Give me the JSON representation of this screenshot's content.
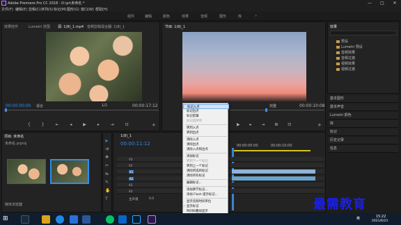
{
  "window": {
    "title": "Adobe Premiere Pro CC 2018 - D:\\pr\\未命名 *",
    "controls": [
      "—",
      "□",
      "✕"
    ]
  },
  "menu": [
    "文件(F)",
    "编辑(E)",
    "剪辑(C)",
    "序列(S)",
    "标记(M)",
    "图形(G)",
    "窗口(W)",
    "帮助(H)"
  ],
  "workspaces": [
    "组件",
    "编辑",
    "颜色",
    "效果",
    "音频",
    "图形",
    "库"
  ],
  "workspaces_overflow": "»",
  "source_panel": {
    "tabs": [
      "效果控件",
      "Lumetri 范围",
      "源: 1(8)_1.mp4",
      "音频剪辑混合器: 1(8)_1"
    ],
    "active_tab": 2,
    "timecode_left": "00:00:00:00",
    "fit": "适合",
    "ratio": "1/2",
    "timecode_right": "00:00:17:12"
  },
  "program_panel": {
    "tab": "节目: 1(8)_1",
    "fit": "完整",
    "timecode_right": "00:00:10:08"
  },
  "context_menu": {
    "items": [
      {
        "label": "标记入点",
        "disabled": false,
        "highlight": true
      },
      {
        "label": "标记出点",
        "disabled": false
      },
      {
        "label": "标记剪辑",
        "disabled": false
      },
      {
        "label": "标记选择项",
        "disabled": true
      },
      {
        "label": "转到入点",
        "disabled": false
      },
      {
        "label": "转到出点",
        "disabled": false
      },
      {
        "label": "清除入点",
        "disabled": false
      },
      {
        "label": "清除出点",
        "disabled": false
      },
      {
        "label": "清除入点和出点",
        "disabled": false
      },
      {
        "label": "添加标记",
        "disabled": false
      },
      {
        "label": "转到下一个标记",
        "disabled": true
      },
      {
        "label": "转到上一个标记",
        "disabled": false
      },
      {
        "label": "清除所选的标记",
        "disabled": false
      },
      {
        "label": "清除所有标记",
        "disabled": false
      },
      {
        "label": "编辑标记...",
        "disabled": false
      },
      {
        "label": "添加章节标记...",
        "disabled": false
      },
      {
        "label": "添加 Flash 提示标记...",
        "disabled": false
      },
      {
        "label": "显示音频时间单位",
        "disabled": false
      },
      {
        "label": "显示标记",
        "disabled": false,
        "checked": true
      },
      {
        "label": "时间码叠加显示",
        "disabled": false
      }
    ]
  },
  "project_panel": {
    "tab": "项目: 未命名",
    "search_placeholder": "未命名.prproj",
    "footer_tab": "媒体浏览器"
  },
  "timeline": {
    "tab": "1(8)_1",
    "timecode": "00:00:11:12",
    "ruler": [
      "00:00:05:00",
      "00:00:10:00",
      "00:00:15:00"
    ],
    "video_tracks": [
      "V3",
      "V2",
      "V1"
    ],
    "audio_tracks": [
      "A1",
      "A2",
      "A3"
    ],
    "master": "主声道",
    "master_value": "0.0"
  },
  "right_panel": {
    "effects_tab": "效果",
    "tree": [
      "预设",
      "Lumetri 预设",
      "音频效果",
      "音频过渡",
      "视频效果",
      "视频过渡"
    ],
    "side_items": [
      "基本图形",
      "基本声音",
      "Lumetri 颜色",
      "库",
      "标记",
      "历史记录",
      "信息"
    ]
  },
  "taskbar": {
    "time": "15:22",
    "date": "2021/6/23",
    "tray_text": "英"
  },
  "watermark": "最需教育",
  "colors": {
    "accent": "#2f8cf0",
    "playhead": "#3d8fe8",
    "menu_bg": "#f0f0f0",
    "highlight": "#cfe2f7"
  }
}
